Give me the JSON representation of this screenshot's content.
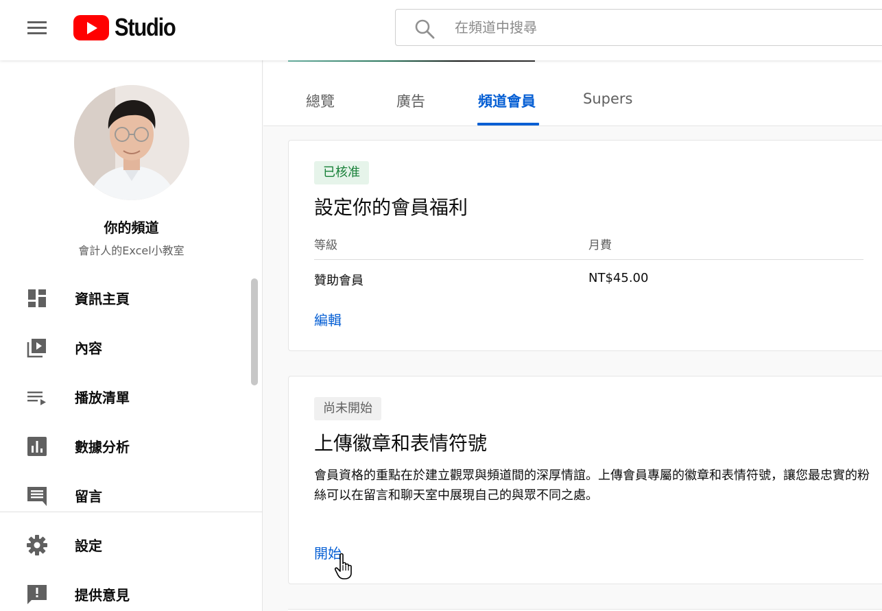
{
  "header": {
    "logo_text": "Studio",
    "search": {
      "placeholder": "在頻道中搜尋"
    }
  },
  "sidebar": {
    "channel_title": "你的頻道",
    "channel_name": "會計人的Excel小教室",
    "items": [
      {
        "label": "資訊主頁",
        "icon": "dashboard-icon"
      },
      {
        "label": "內容",
        "icon": "video-library-icon"
      },
      {
        "label": "播放清單",
        "icon": "playlist-icon"
      },
      {
        "label": "數據分析",
        "icon": "analytics-icon"
      },
      {
        "label": "留言",
        "icon": "comment-icon"
      },
      {
        "label": "設定",
        "icon": "gear-icon"
      },
      {
        "label": "提供意見",
        "icon": "feedback-icon"
      }
    ]
  },
  "tabs": [
    {
      "label": "總覽",
      "active": false
    },
    {
      "label": "廣告",
      "active": false
    },
    {
      "label": "頻道會員",
      "active": true
    },
    {
      "label": "Supers",
      "active": false
    }
  ],
  "cards": [
    {
      "status": "已核准",
      "title": "設定你的會員福利",
      "table": {
        "headers": [
          "等級",
          "月費"
        ],
        "rows": [
          [
            "贊助會員",
            "NT$45.00"
          ]
        ]
      },
      "action": "編輯"
    },
    {
      "status": "尚未開始",
      "title": "上傳徽章和表情符號",
      "description": "會員資格的重點在於建立觀眾與頻道間的深厚情誼。上傳會員專屬的徽章和表情符號，讓您最忠實的粉絲可以在留言和聊天室中展現自己的與眾不同之處。",
      "action": "開始"
    }
  ],
  "colors": {
    "brand_red": "#ff0000",
    "accent_blue": "#065fd4",
    "approved_green": "#188038",
    "approved_bg": "#e6f4ea"
  }
}
